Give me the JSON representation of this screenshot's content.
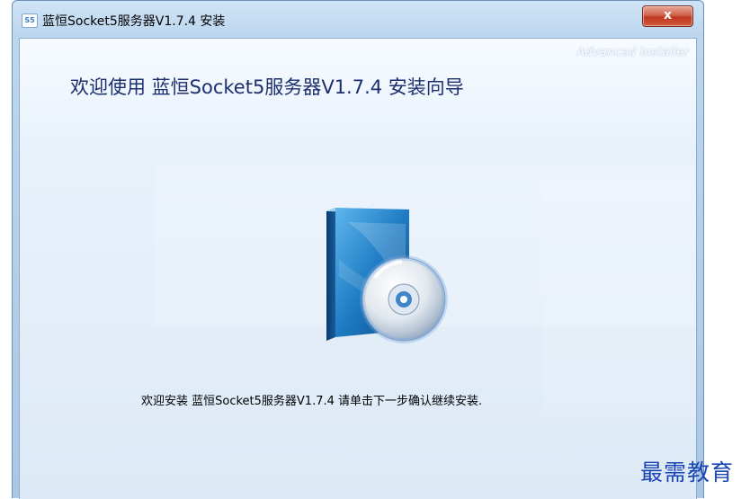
{
  "window": {
    "title": "蓝恒Socket5服务器V1.7.4 安装",
    "icon_label": "S5",
    "close_label": "x"
  },
  "header": {
    "watermark": "Advanced Installer",
    "heading": "欢迎使用 蓝恒Socket5服务器V1.7.4 安装向导"
  },
  "main": {
    "graphic": "software-box-with-cd-icon",
    "body_text": "欢迎安装 蓝恒Socket5服务器V1.7.4 请单击下一步确认继续安装."
  },
  "overlay": {
    "brand_text": "最需教育"
  },
  "colors": {
    "heading": "#1c2f6e",
    "close_button": "#c0381f",
    "brand": "#1a45b5"
  }
}
